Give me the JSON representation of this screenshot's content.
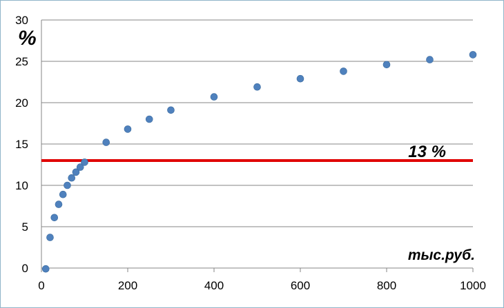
{
  "chart_data": {
    "type": "scatter",
    "title": "",
    "xlabel": "тыс.руб.",
    "ylabel": "%",
    "xlim": [
      0,
      1000
    ],
    "ylim": [
      0,
      30
    ],
    "x_ticks": [
      0,
      200,
      400,
      600,
      800,
      1000
    ],
    "y_ticks": [
      0,
      5,
      10,
      15,
      20,
      25,
      30
    ],
    "grid": "horizontal",
    "legend": "none",
    "series": [
      {
        "color": "#4F81BD",
        "points": [
          {
            "x": 10,
            "y": -0.1
          },
          {
            "x": 20,
            "y": 3.7
          },
          {
            "x": 30,
            "y": 6.1
          },
          {
            "x": 40,
            "y": 7.7
          },
          {
            "x": 50,
            "y": 8.9
          },
          {
            "x": 60,
            "y": 10.0
          },
          {
            "x": 70,
            "y": 10.9
          },
          {
            "x": 80,
            "y": 11.6
          },
          {
            "x": 90,
            "y": 12.2
          },
          {
            "x": 100,
            "y": 12.8
          },
          {
            "x": 150,
            "y": 15.2
          },
          {
            "x": 200,
            "y": 16.8
          },
          {
            "x": 250,
            "y": 18.0
          },
          {
            "x": 300,
            "y": 19.1
          },
          {
            "x": 400,
            "y": 20.7
          },
          {
            "x": 500,
            "y": 21.9
          },
          {
            "x": 600,
            "y": 22.9
          },
          {
            "x": 700,
            "y": 23.8
          },
          {
            "x": 800,
            "y": 24.6
          },
          {
            "x": 900,
            "y": 25.2
          },
          {
            "x": 1000,
            "y": 25.8
          }
        ]
      }
    ],
    "reference_line": {
      "y": 13,
      "x_range": [
        0,
        1000
      ],
      "color": "#E00000",
      "label": "13 %"
    }
  }
}
